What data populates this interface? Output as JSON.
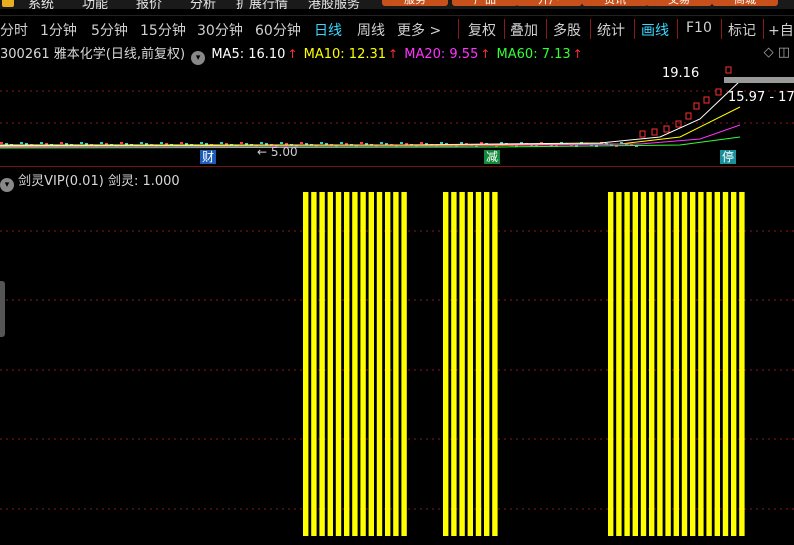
{
  "menu": {
    "items": [
      "系统",
      "功能",
      "报价",
      "分析",
      "扩展行情",
      "港股服务"
    ],
    "orange_buttons": [
      "服务",
      "产品",
      "开户",
      "资讯",
      "交易",
      "商城"
    ]
  },
  "toolbar": {
    "periods": [
      "分时",
      "1分钟",
      "5分钟",
      "15分钟",
      "30分钟",
      "60分钟",
      "日线",
      "周线",
      "更多 >"
    ],
    "active_period": "日线",
    "tools": [
      "复权",
      "叠加",
      "多股",
      "统计",
      "画线",
      "F10",
      "标记",
      "+自选"
    ],
    "active_tool": "画线"
  },
  "stock": {
    "code_name": "300261 雅本化学(日线,前复权)",
    "ma5": "MA5: 16.10",
    "ma10": "MA10: 12.31",
    "ma20": "MA20: 9.55",
    "ma60": "MA60: 7.13"
  },
  "colors": {
    "ma5": "#ffffff",
    "ma10": "#ffff00",
    "ma20": "#ff33ff",
    "ma60": "#33ff33",
    "active": "#3ad7ff",
    "bar": "#ffff00",
    "grid": "#8a1a1a"
  },
  "price_labels": {
    "high": "19.16",
    "range": "15.97 - 17",
    "low": "← 5.00"
  },
  "events": [
    {
      "label": "财",
      "color": "#1d5bb8"
    },
    {
      "label": "减",
      "color": "#138a3a"
    },
    {
      "label": "停",
      "color": "#1b8f9a"
    }
  ],
  "indicator": {
    "name": "剑灵VIP(0.01)",
    "value": "剑灵: 1.000",
    "bar_value": 1.0,
    "groups_bar_count": [
      13,
      7,
      17
    ]
  }
}
